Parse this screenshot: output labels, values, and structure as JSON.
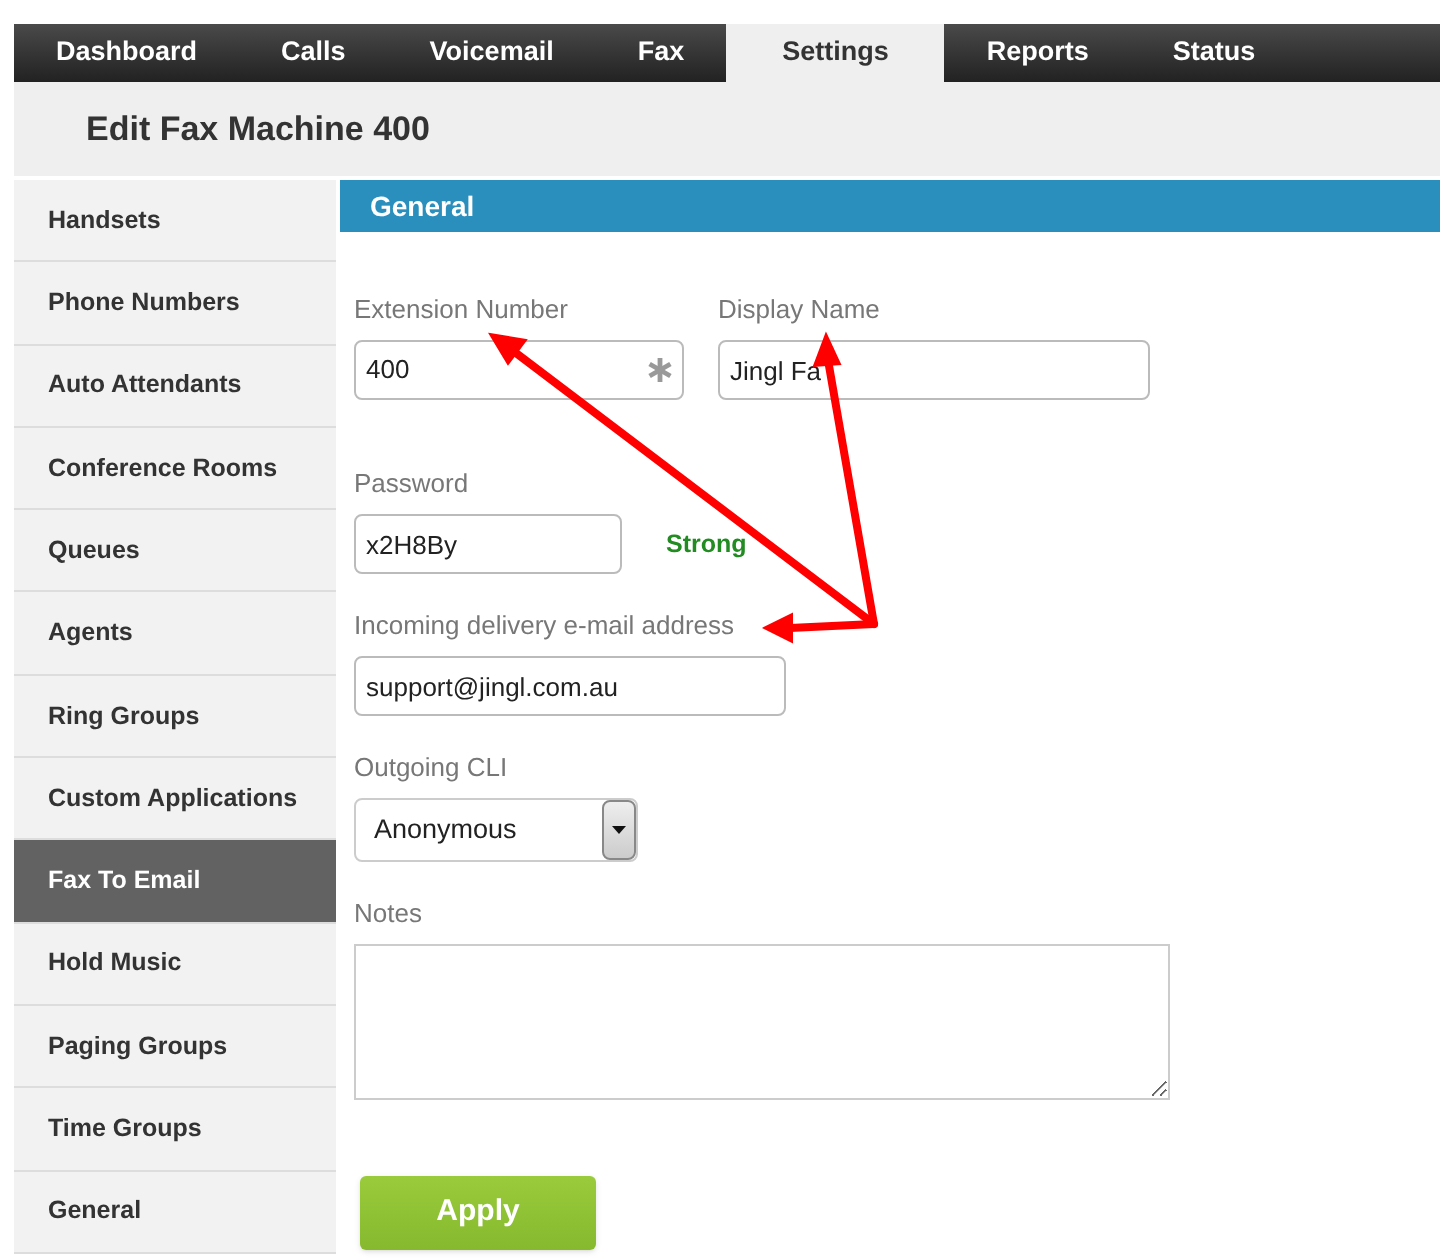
{
  "nav": {
    "tabs": [
      {
        "label": "Dashboard",
        "selected": false
      },
      {
        "label": "Calls",
        "selected": false
      },
      {
        "label": "Voicemail",
        "selected": false
      },
      {
        "label": "Fax",
        "selected": false
      },
      {
        "label": "Settings",
        "selected": true
      },
      {
        "label": "Reports",
        "selected": false
      },
      {
        "label": "Status",
        "selected": false
      }
    ]
  },
  "page_title": "Edit Fax Machine 400",
  "sidebar": {
    "items": [
      {
        "label": "Handsets",
        "selected": false
      },
      {
        "label": "Phone Numbers",
        "selected": false
      },
      {
        "label": "Auto Attendants",
        "selected": false
      },
      {
        "label": "Conference Rooms",
        "selected": false
      },
      {
        "label": "Queues",
        "selected": false
      },
      {
        "label": "Agents",
        "selected": false
      },
      {
        "label": "Ring Groups",
        "selected": false
      },
      {
        "label": "Custom Applications",
        "selected": false
      },
      {
        "label": "Fax To Email",
        "selected": true
      },
      {
        "label": "Hold Music",
        "selected": false
      },
      {
        "label": "Paging Groups",
        "selected": false
      },
      {
        "label": "Time Groups",
        "selected": false
      },
      {
        "label": "General",
        "selected": false
      }
    ]
  },
  "section": {
    "title": "General"
  },
  "form": {
    "extension": {
      "label": "Extension Number",
      "value": "400",
      "required": true
    },
    "display_name": {
      "label": "Display Name",
      "value": "Jingl Fa"
    },
    "password": {
      "label": "Password",
      "value": "x2H8By",
      "strength": "Strong"
    },
    "email": {
      "label": "Incoming delivery e-mail address",
      "value": "support@jingl.com.au"
    },
    "outgoing_cli": {
      "label": "Outgoing CLI",
      "value": "Anonymous"
    },
    "notes": {
      "label": "Notes"
    }
  },
  "apply_button": "Apply"
}
